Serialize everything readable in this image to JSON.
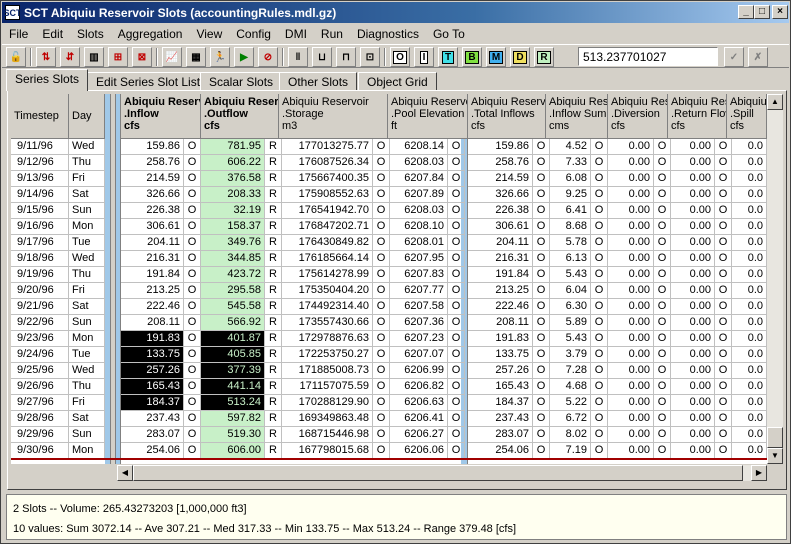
{
  "window": {
    "title": "SCT Abiquiu Reservoir Slots (accountingRules.mdl.gz)",
    "icon": "SCT"
  },
  "menu": [
    "File",
    "Edit",
    "Slots",
    "Aggregation",
    "View",
    "Config",
    "DMI",
    "Run",
    "Diagnostics",
    "Go To"
  ],
  "toolbar": {
    "letters": [
      "O",
      "I",
      "T",
      "B",
      "M",
      "D",
      "R"
    ],
    "letter_colors": [
      "#ffffff",
      "#ffffff",
      "#40e0e8",
      "#80e040",
      "#40b0f0",
      "#f0e060",
      "#c0f0c0"
    ],
    "value": "513.237701027"
  },
  "tabs": [
    "Series Slots",
    "Edit Series Slot List",
    "Scalar Slots",
    "Other Slots",
    "Object Grid"
  ],
  "grid": {
    "headers": [
      {
        "text": "Timestep",
        "bold": false
      },
      {
        "text": "Day",
        "bold": false
      },
      {
        "text": "Abiquiu Reservoir\n.Inflow\ncfs",
        "bold": true
      },
      {
        "text": "Abiquiu Reservoir\n.Outflow\ncfs",
        "bold": true
      },
      {
        "text": "Abiquiu Reservoir\n.Storage\nm3",
        "bold": false
      },
      {
        "text": "Abiquiu Reservoir\n.Pool Elevation\nft",
        "bold": false
      },
      {
        "text": "Abiquiu Reservoir\n.Total Inflows\ncfs",
        "bold": false
      },
      {
        "text": "Abiquiu Reservoir\n.Inflow Sum\ncms",
        "bold": false
      },
      {
        "text": "Abiquiu Reservoir\n.Diversion\ncfs",
        "bold": false
      },
      {
        "text": "Abiquiu Reservoir\n.Return Flow\ncfs",
        "bold": false
      },
      {
        "text": "Abiquiu Reservoir\n.Spill\ncfs",
        "bold": false
      }
    ],
    "rows": [
      [
        "9/11/96",
        "Wed",
        "159.86",
        "O",
        "781.95",
        "R",
        "177013275.77",
        "O",
        "6208.14",
        "O",
        "159.86",
        "O",
        "4.52",
        "O",
        "0.00",
        "O",
        "0.00",
        "O",
        "0.0"
      ],
      [
        "9/12/96",
        "Thu",
        "258.76",
        "O",
        "606.22",
        "R",
        "176087526.34",
        "O",
        "6208.03",
        "O",
        "258.76",
        "O",
        "7.33",
        "O",
        "0.00",
        "O",
        "0.00",
        "O",
        "0.0"
      ],
      [
        "9/13/96",
        "Fri",
        "214.59",
        "O",
        "376.58",
        "R",
        "175667400.35",
        "O",
        "6207.84",
        "O",
        "214.59",
        "O",
        "6.08",
        "O",
        "0.00",
        "O",
        "0.00",
        "O",
        "0.0"
      ],
      [
        "9/14/96",
        "Sat",
        "326.66",
        "O",
        "208.33",
        "R",
        "175908552.63",
        "O",
        "6207.89",
        "O",
        "326.66",
        "O",
        "9.25",
        "O",
        "0.00",
        "O",
        "0.00",
        "O",
        "0.0"
      ],
      [
        "9/15/96",
        "Sun",
        "226.38",
        "O",
        "32.19",
        "R",
        "176541942.70",
        "O",
        "6208.03",
        "O",
        "226.38",
        "O",
        "6.41",
        "O",
        "0.00",
        "O",
        "0.00",
        "O",
        "0.0"
      ],
      [
        "9/16/96",
        "Mon",
        "306.61",
        "O",
        "158.37",
        "R",
        "176847202.71",
        "O",
        "6208.10",
        "O",
        "306.61",
        "O",
        "8.68",
        "O",
        "0.00",
        "O",
        "0.00",
        "O",
        "0.0"
      ],
      [
        "9/17/96",
        "Tue",
        "204.11",
        "O",
        "349.76",
        "R",
        "176430849.82",
        "O",
        "6208.01",
        "O",
        "204.11",
        "O",
        "5.78",
        "O",
        "0.00",
        "O",
        "0.00",
        "O",
        "0.0"
      ],
      [
        "9/18/96",
        "Wed",
        "216.31",
        "O",
        "344.85",
        "R",
        "176185664.14",
        "O",
        "6207.95",
        "O",
        "216.31",
        "O",
        "6.13",
        "O",
        "0.00",
        "O",
        "0.00",
        "O",
        "0.0"
      ],
      [
        "9/19/96",
        "Thu",
        "191.84",
        "O",
        "423.72",
        "R",
        "175614278.99",
        "O",
        "6207.83",
        "O",
        "191.84",
        "O",
        "5.43",
        "O",
        "0.00",
        "O",
        "0.00",
        "O",
        "0.0"
      ],
      [
        "9/20/96",
        "Fri",
        "213.25",
        "O",
        "295.58",
        "R",
        "175350404.20",
        "O",
        "6207.77",
        "O",
        "213.25",
        "O",
        "6.04",
        "O",
        "0.00",
        "O",
        "0.00",
        "O",
        "0.0"
      ],
      [
        "9/21/96",
        "Sat",
        "222.46",
        "O",
        "545.58",
        "R",
        "174492314.40",
        "O",
        "6207.58",
        "O",
        "222.46",
        "O",
        "6.30",
        "O",
        "0.00",
        "O",
        "0.00",
        "O",
        "0.0"
      ],
      [
        "9/22/96",
        "Sun",
        "208.11",
        "O",
        "566.92",
        "R",
        "173557430.66",
        "O",
        "6207.36",
        "O",
        "208.11",
        "O",
        "5.89",
        "O",
        "0.00",
        "O",
        "0.00",
        "O",
        "0.0"
      ],
      [
        "9/23/96",
        "Mon",
        "191.83",
        "O",
        "401.87",
        "R",
        "172978876.63",
        "O",
        "6207.23",
        "O",
        "191.83",
        "O",
        "5.43",
        "O",
        "0.00",
        "O",
        "0.00",
        "O",
        "0.0"
      ],
      [
        "9/24/96",
        "Tue",
        "133.75",
        "O",
        "405.85",
        "R",
        "172253750.27",
        "O",
        "6207.07",
        "O",
        "133.75",
        "O",
        "3.79",
        "O",
        "0.00",
        "O",
        "0.00",
        "O",
        "0.0"
      ],
      [
        "9/25/96",
        "Wed",
        "257.26",
        "O",
        "377.39",
        "R",
        "171885008.73",
        "O",
        "6206.99",
        "O",
        "257.26",
        "O",
        "7.28",
        "O",
        "0.00",
        "O",
        "0.00",
        "O",
        "0.0"
      ],
      [
        "9/26/96",
        "Thu",
        "165.43",
        "O",
        "441.14",
        "R",
        "171157075.59",
        "O",
        "6206.82",
        "O",
        "165.43",
        "O",
        "4.68",
        "O",
        "0.00",
        "O",
        "0.00",
        "O",
        "0.0"
      ],
      [
        "9/27/96",
        "Fri",
        "184.37",
        "O",
        "513.24",
        "R",
        "170288129.90",
        "O",
        "6206.63",
        "O",
        "184.37",
        "O",
        "5.22",
        "O",
        "0.00",
        "O",
        "0.00",
        "O",
        "0.0"
      ],
      [
        "9/28/96",
        "Sat",
        "237.43",
        "O",
        "597.82",
        "R",
        "169349863.48",
        "O",
        "6206.41",
        "O",
        "237.43",
        "O",
        "6.72",
        "O",
        "0.00",
        "O",
        "0.00",
        "O",
        "0.0"
      ],
      [
        "9/29/96",
        "Sun",
        "283.07",
        "O",
        "519.30",
        "R",
        "168715446.98",
        "O",
        "6206.27",
        "O",
        "283.07",
        "O",
        "8.02",
        "O",
        "0.00",
        "O",
        "0.00",
        "O",
        "0.0"
      ],
      [
        "9/30/96",
        "Mon",
        "254.06",
        "O",
        "606.00",
        "R",
        "167798015.68",
        "O",
        "6206.06",
        "O",
        "254.06",
        "O",
        "7.19",
        "O",
        "0.00",
        "O",
        "0.00",
        "O",
        "0.0"
      ]
    ],
    "selected_rows": [
      12,
      13,
      14,
      15,
      16
    ],
    "colors": {
      "outflow_bg": "#c8f0c8",
      "selected_bg": "#000000",
      "selected_fg": "#ffffff",
      "accent_bar": "#a0c8e8"
    }
  },
  "status": {
    "line1": "2 Slots -- Volume: 265.43273203 [1,000,000 ft3]",
    "line2": "10 values:  Sum 3072.14 -- Ave 307.21 -- Med 317.33 -- Min 133.75 -- Max 513.24 -- Range 379.48 [cfs]"
  }
}
